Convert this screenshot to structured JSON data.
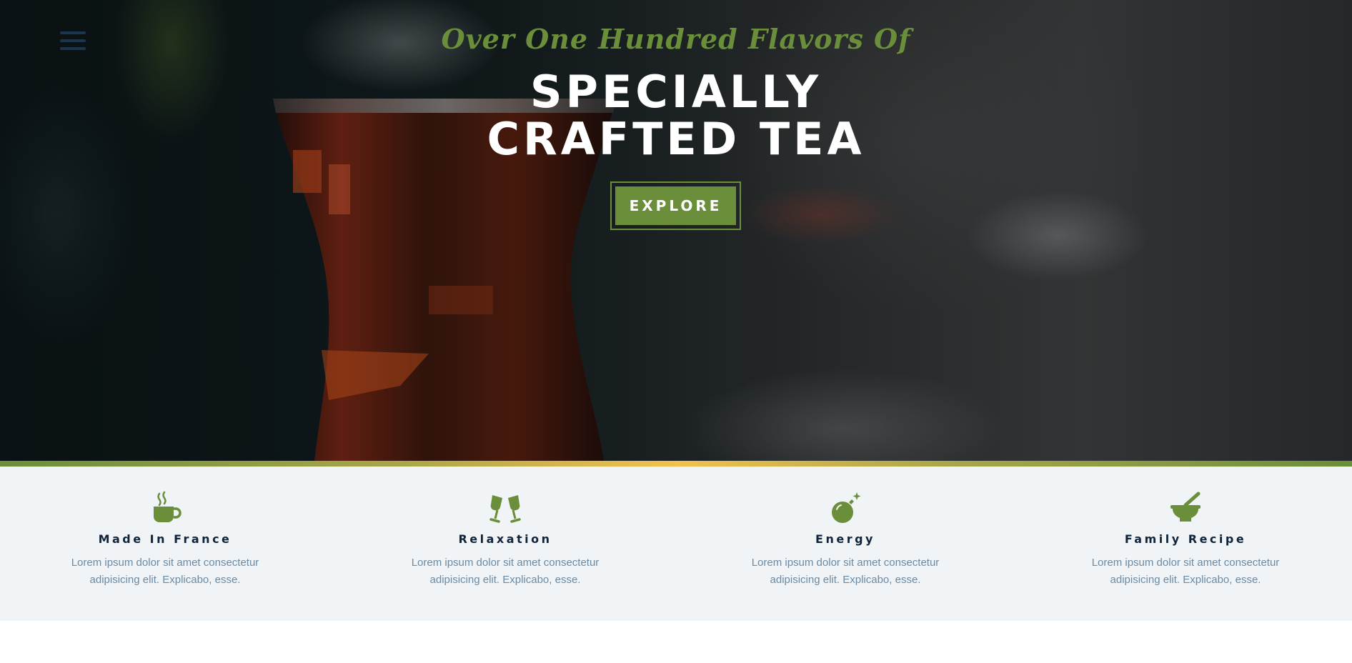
{
  "hero": {
    "script_text": "Over One Hundred Flavors Of",
    "title_line1": "SPECIALLY",
    "title_line2": "CRAFTED TEA",
    "button_label": "EXPLORE"
  },
  "nav": {
    "menu_icon": "hamburger-menu-icon"
  },
  "colors": {
    "accent_green": "#6a8e3a",
    "accent_gold": "#f2c14e",
    "heading_dark": "#10243a",
    "body_text": "#6a8aa4",
    "features_bg": "#f0f4f7"
  },
  "features": [
    {
      "icon": "mug-hot-icon",
      "title": "Made In France",
      "text_line1": "Lorem ipsum dolor sit amet consectetur",
      "text_line2": "adipisicing elit. Explicabo, esse."
    },
    {
      "icon": "glass-cheers-icon",
      "title": "Relaxation",
      "text_line1": "Lorem ipsum dolor sit amet consectetur",
      "text_line2": "adipisicing elit. Explicabo, esse."
    },
    {
      "icon": "bomb-icon",
      "title": "Energy",
      "text_line1": "Lorem ipsum dolor sit amet consectetur",
      "text_line2": "adipisicing elit. Explicabo, esse."
    },
    {
      "icon": "mortar-pestle-icon",
      "title": "Family Recipe",
      "text_line1": "Lorem ipsum dolor sit amet consectetur",
      "text_line2": "adipisicing elit. Explicabo, esse."
    }
  ]
}
